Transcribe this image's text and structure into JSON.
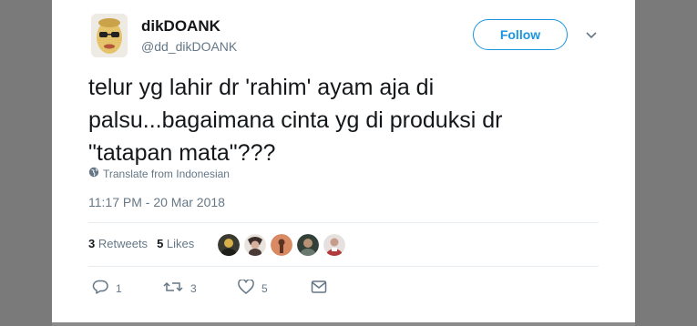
{
  "user": {
    "display_name": "dikDOANK",
    "handle": "@dd_dikDOANK",
    "avatar_icon": "avatar-face"
  },
  "follow_label": "Follow",
  "tweet": {
    "lines": [
      "telur yg lahir dr 'rahim' ayam aja di",
      "palsu...bagaimana cinta yg di produksi dr",
      "\"tatapan mata\"???"
    ],
    "translate_label": "Translate from Indonesian",
    "timestamp": "11:17 PM - 20 Mar 2018"
  },
  "stats": {
    "retweets_count": "3",
    "retweets_label": "Retweets",
    "likes_count": "5",
    "likes_label": "Likes"
  },
  "likers": [
    {
      "icon": "liker-avatar-1"
    },
    {
      "icon": "liker-avatar-2"
    },
    {
      "icon": "liker-avatar-3"
    },
    {
      "icon": "liker-avatar-4"
    },
    {
      "icon": "liker-avatar-5"
    }
  ],
  "actions": {
    "reply_count": "1",
    "retweet_count": "3",
    "like_count": "5"
  },
  "colors": {
    "accent": "#1b95e0",
    "text": "#14171a",
    "muted": "#657786"
  }
}
